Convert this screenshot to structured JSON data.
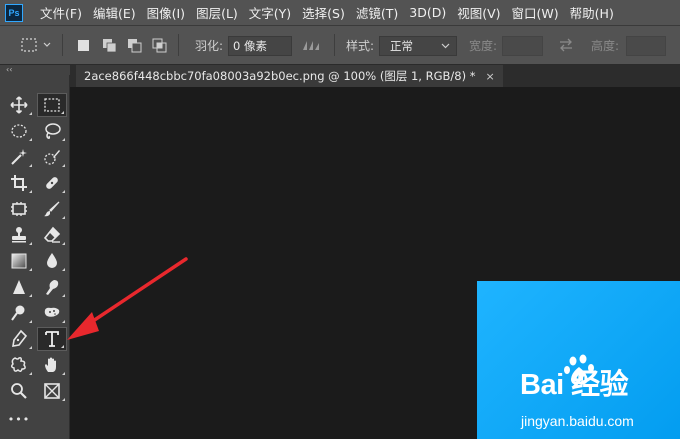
{
  "app": {
    "logo_text": "Ps"
  },
  "menu": {
    "items": [
      "文件(F)",
      "编辑(E)",
      "图像(I)",
      "图层(L)",
      "文字(Y)",
      "选择(S)",
      "滤镜(T)",
      "3D(D)",
      "视图(V)",
      "窗口(W)",
      "帮助(H)"
    ]
  },
  "options": {
    "feather_label": "羽化:",
    "feather_value": "0 像素",
    "style_label": "样式:",
    "style_value": "正常",
    "width_label": "宽度:",
    "height_label": "高度:"
  },
  "toolbar": {
    "collapse_glyph": "‹‹",
    "more_glyph": "•••",
    "active_tool": "type-tool",
    "icons": [
      "move-icon",
      "rect-marquee-icon",
      "ellipse-marquee-icon",
      "lasso-icon",
      "magic-wand-icon",
      "quick-select-icon",
      "crop-icon",
      "healing-brush-icon",
      "frame-icon",
      "brush-icon",
      "stamp-icon",
      "eraser-icon",
      "gradient-icon",
      "drop-blur-icon",
      "sharpen-icon",
      "smudge-icon",
      "dodge-icon",
      "sponge-icon",
      "pen-icon",
      "type-icon",
      "custom-shape-icon",
      "hand-icon",
      "zoom-icon",
      "rectangle-frame-icon",
      "more-tools-icon"
    ]
  },
  "document": {
    "tab_title": "2ace866f448cbbc70fa08003a92b0ec.png @ 100% (图层 1, RGB/8) *",
    "close_glyph": "×"
  },
  "watermark": {
    "brand": "Bai  经验",
    "url": "jingyan.baidu.com"
  },
  "colors": {
    "menubar_bg": "#535353",
    "toolbar_bg": "#424242",
    "canvas_bg": "#1b1b1b",
    "image_blue": "#0aa6f3",
    "annotation_red": "#e8282d",
    "ps_blue": "#31a8ff"
  }
}
